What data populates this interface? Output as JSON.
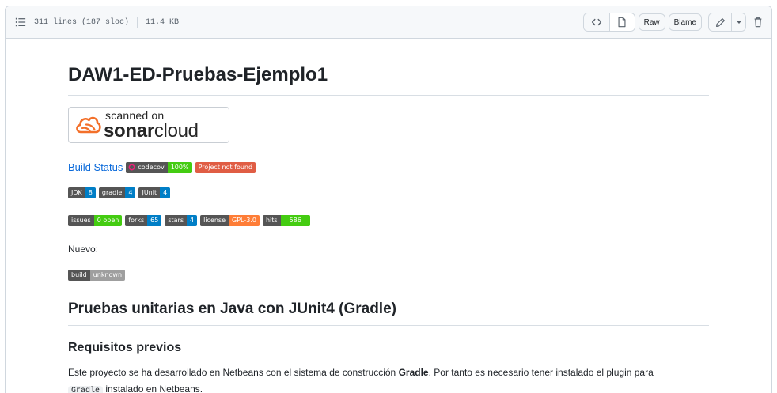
{
  "header": {
    "lines": "311 lines (187 sloc)",
    "size": "11.4 KB",
    "raw_label": "Raw",
    "blame_label": "Blame"
  },
  "readme": {
    "title": "DAW1-ED-Pruebas-Ejemplo1",
    "sonar": {
      "scanned": "scanned on",
      "brand_bold": "sonar",
      "brand_light": "cloud"
    },
    "build_status_link": "Build Status",
    "badges_row1": [
      {
        "label": "codecov",
        "value": "100%",
        "color": "#4c1"
      },
      {
        "value": "Project not found",
        "color": "#e05d44"
      }
    ],
    "badges_row2": [
      {
        "label": "JDK",
        "value": "8",
        "color": "#007ec6"
      },
      {
        "label": "gradle",
        "value": "4",
        "color": "#007ec6"
      },
      {
        "label": "JUnit",
        "value": "4",
        "color": "#007ec6"
      }
    ],
    "badges_row3": [
      {
        "label": "issues",
        "value": "0 open",
        "color": "#4c1"
      },
      {
        "label": "forks",
        "value": "65",
        "color": "#007ec6"
      },
      {
        "label": "stars",
        "value": "4",
        "color": "#007ec6"
      },
      {
        "label": "license",
        "value": "GPL-3.0",
        "color": "#fe7d37"
      },
      {
        "label": "hits",
        "value": "586",
        "color": "#4c1"
      }
    ],
    "nuevo": "Nuevo:",
    "badge_build": {
      "label": "build",
      "value": "unknown",
      "color": "#9f9f9f"
    },
    "h2": "Pruebas unitarias en Java con JUnit4 (Gradle)",
    "h3": "Requisitos previos",
    "para_part1": "Este proyecto se ha desarrollado en Netbeans con el sistema de construcción ",
    "para_bold": "Gradle",
    "para_part2": ". Por tanto es necesario tener instalado el plugin para",
    "para_code": "Gradle",
    "para_part3": " instalado en Netbeans."
  }
}
